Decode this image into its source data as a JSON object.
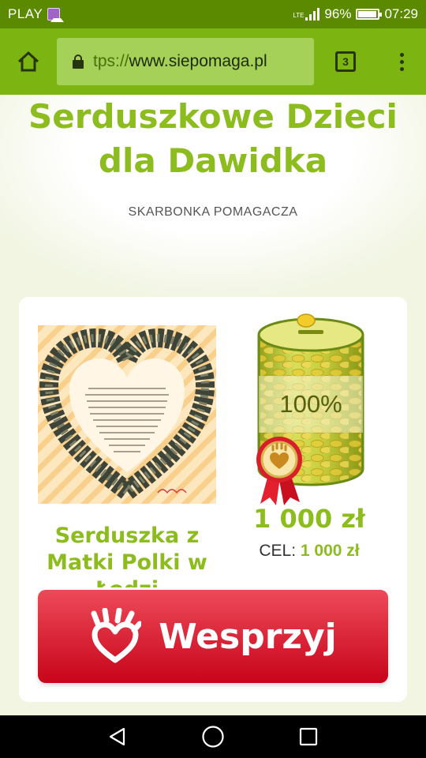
{
  "status_bar": {
    "carrier": "PLAY",
    "network": "LTE",
    "battery": "96%",
    "battery_level": 0.96,
    "time": "07:29"
  },
  "browser": {
    "url_scheme": "tps://",
    "url_host": "www.siepomaga.pl",
    "tab_count": "3"
  },
  "page": {
    "title": "Serduszkowe Dzieci dla Dawidka",
    "subtitle": "SKARBONKA POMAGACZA"
  },
  "campaign": {
    "title": "Serduszka z Matki Polki w Łodzi",
    "progress_label": "100%",
    "progress_fraction": 1.0,
    "raised": "1 000 zł",
    "goal_label": "CEL:",
    "goal_value": "1 000 zł",
    "support_label": "Wesprzyj"
  },
  "colors": {
    "brand_green": "#8cbc1e",
    "toolbar_green": "#7cb512",
    "status_green": "#5b8a00",
    "button_red": "#d9172b"
  },
  "icons": {
    "home": "home-icon",
    "lock": "lock-icon",
    "menu": "more-vert-icon",
    "hand_heart": "hand-heart-icon",
    "award": "award-ribbon-icon"
  }
}
